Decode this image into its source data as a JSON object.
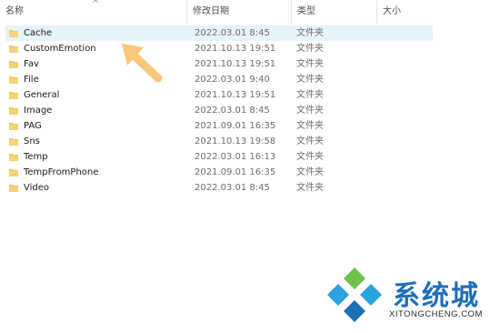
{
  "columns": {
    "name": "名称",
    "modified": "修改日期",
    "type": "类型",
    "size": "大小"
  },
  "colors": {
    "selected_row": "#e5f3fb",
    "folder": "#f3c463",
    "arrow": "#f7c87a",
    "watermark_blue": "#1d6fb8"
  },
  "files": [
    {
      "name": "Cache",
      "date": "2022.03.01 8:45",
      "type": "文件夹",
      "selected": true
    },
    {
      "name": "CustomEmotion",
      "date": "2021.10.13 19:51",
      "type": "文件夹"
    },
    {
      "name": "Fav",
      "date": "2021.10.13 19:51",
      "type": "文件夹"
    },
    {
      "name": "File",
      "date": "2022.03.01 9:40",
      "type": "文件夹"
    },
    {
      "name": "General",
      "date": "2021.10.13 19:51",
      "type": "文件夹"
    },
    {
      "name": "Image",
      "date": "2022.03.01 8:45",
      "type": "文件夹"
    },
    {
      "name": "PAG",
      "date": "2021.09.01 16:35",
      "type": "文件夹"
    },
    {
      "name": "Sns",
      "date": "2021.10.13 19:58",
      "type": "文件夹"
    },
    {
      "name": "Temp",
      "date": "2022.03.01 16:13",
      "type": "文件夹"
    },
    {
      "name": "TempFromPhone",
      "date": "2021.09.01 16:35",
      "type": "文件夹"
    },
    {
      "name": "Video",
      "date": "2022.03.01 8:45",
      "type": "文件夹"
    }
  ],
  "watermark": {
    "text": "系统城",
    "subtext": "XITONGCHENG.COM"
  }
}
